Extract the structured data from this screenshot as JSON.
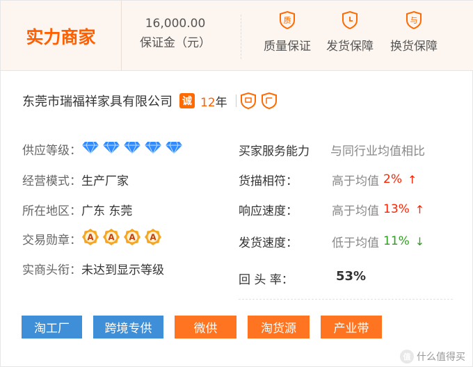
{
  "header": {
    "brand": "实力商家",
    "deposit_amount": "16,000.00",
    "deposit_label": "保证金（元）",
    "guarantees": [
      {
        "icon": "quality-shield-icon",
        "glyph": "质",
        "label": "质量保证"
      },
      {
        "icon": "delivery-clock-icon",
        "glyph": "⏱",
        "label": "发货保障"
      },
      {
        "icon": "exchange-icon",
        "glyph": "与",
        "label": "换货保障"
      }
    ]
  },
  "company": {
    "name": "东莞市瑞福祥家具有限公司",
    "cheng_badge": "诚",
    "years_num": "12",
    "years_unit": "年"
  },
  "info": {
    "supply_level_label": "供应等级：",
    "supply_level_diamonds": 5,
    "business_mode_label": "经营模式：",
    "business_mode_value": "生产厂家",
    "region_label": "所在地区：",
    "region_value": "广东 东莞",
    "trade_medal_label": "交易勋章：",
    "trade_medals": 4,
    "medal_glyph": "A",
    "merchant_title_label": "实商头衔：",
    "merchant_title_value": "未达到显示等级"
  },
  "service": {
    "title": "买家服务能力",
    "compare": "与同行业均值相比",
    "rows": [
      {
        "label": "货描相符：",
        "cmp": "高于均值",
        "pct": "2%",
        "dir": "up",
        "arrow": "↑"
      },
      {
        "label": "响应速度：",
        "cmp": "高于均值",
        "pct": "13%",
        "dir": "up",
        "arrow": "↑"
      },
      {
        "label": "发货速度：",
        "cmp": "低于均值",
        "pct": "11%",
        "dir": "down",
        "arrow": "↓"
      }
    ],
    "repeat_label": "回 头 率：",
    "repeat_value": "53%"
  },
  "tags": [
    {
      "label": "淘工厂",
      "color": "blue"
    },
    {
      "label": "跨境专供",
      "color": "blue"
    },
    {
      "label": "微供",
      "color": "orange"
    },
    {
      "label": "淘货源",
      "color": "orange"
    },
    {
      "label": "产业带",
      "color": "orange"
    }
  ],
  "watermark": {
    "badge": "值",
    "text": "什么值得买"
  },
  "colors": {
    "accent_orange": "#ff5f00",
    "tag_blue": "#3f8fd8",
    "tag_orange": "#ff7420",
    "up_red": "#ff2200",
    "down_green": "#2e9e1f",
    "diamond_blue": "#2f8bff",
    "medal_gold": "#f5a623"
  }
}
